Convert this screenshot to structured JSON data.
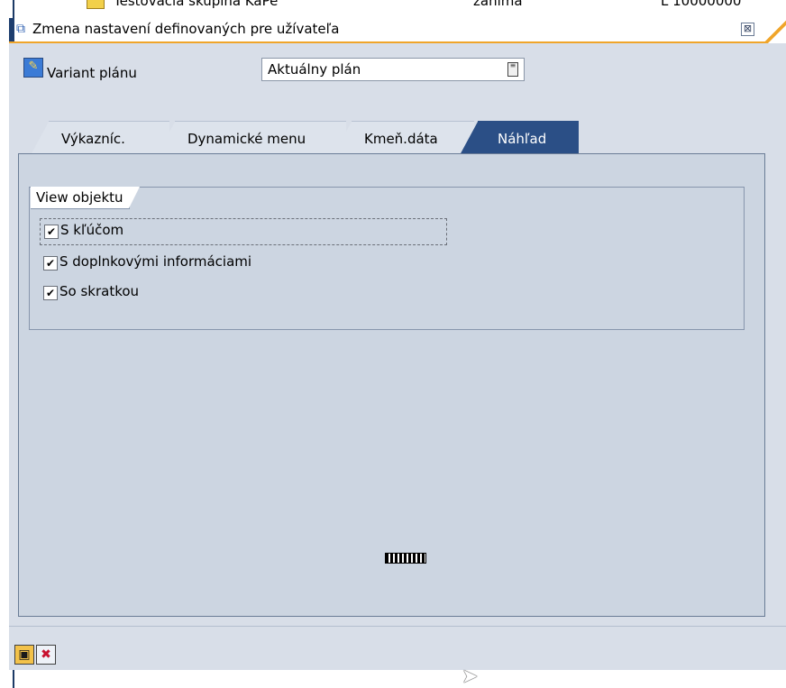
{
  "background_row": {
    "name": "Testovacia skupina KaPe",
    "col2": "zanima",
    "col3": "L 10000000"
  },
  "dialog": {
    "title": "Zmena nastavení definovaných pre užívateľa",
    "close_glyph": "⊠"
  },
  "variant": {
    "label": "Variant plánu",
    "value": "Aktuálny plán"
  },
  "tabs": [
    {
      "label": "Výkazníc.",
      "active": false
    },
    {
      "label": "Dynamické menu",
      "active": false
    },
    {
      "label": "Kmeň.dáta",
      "active": false
    },
    {
      "label": "Náhľad",
      "active": true
    }
  ],
  "group": {
    "title": "View objektu",
    "options": [
      {
        "label": "S kľúčom",
        "checked": true
      },
      {
        "label": "S doplnkovými informáciami",
        "checked": true
      },
      {
        "label": "So skratkou",
        "checked": true
      }
    ]
  },
  "toolbar": {
    "save_icon": "save-icon",
    "cancel_icon": "cancel-icon"
  },
  "colors": {
    "active_tab": "#2b4f86",
    "title_accent": "#f0a52a",
    "panel": "#ccd5e1"
  }
}
